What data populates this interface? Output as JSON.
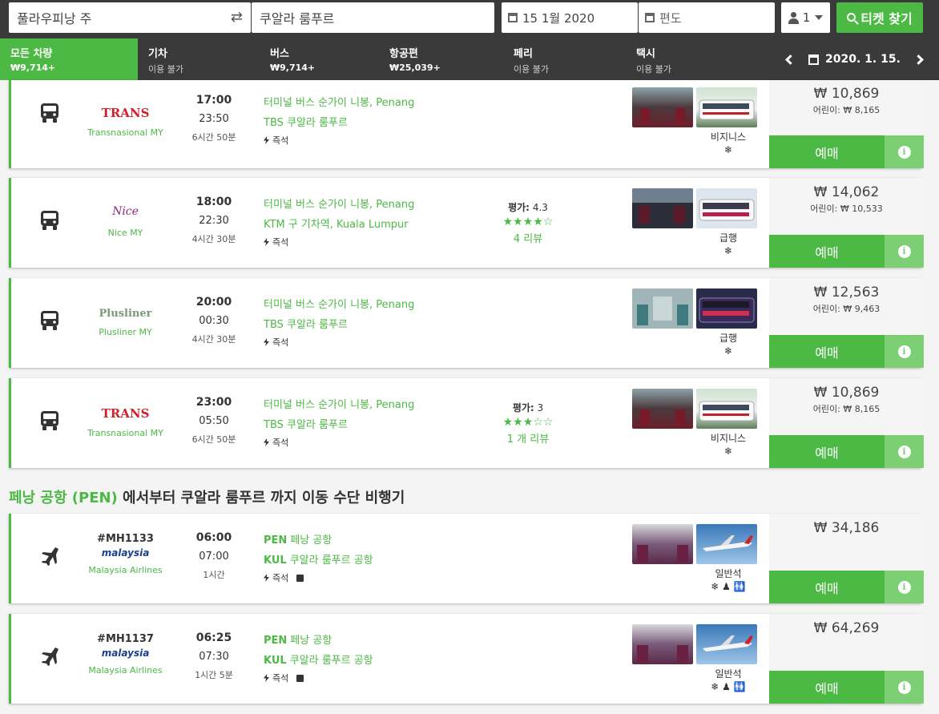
{
  "search": {
    "from": "풀라우피낭 주",
    "to": "쿠알라 룸푸르",
    "date": "15 1월 2020",
    "return_placeholder": "편도",
    "passengers": "1",
    "search_button": "티켓 찾기"
  },
  "tabs": [
    {
      "name": "모든 차량",
      "sub": "₩9,714+"
    },
    {
      "name": "기차",
      "sub": "이용 불가"
    },
    {
      "name": "버스",
      "sub": "₩9,714+"
    },
    {
      "name": "항공편",
      "sub": "₩25,039+"
    },
    {
      "name": "페리",
      "sub": "이용 불가"
    },
    {
      "name": "택시",
      "sub": "이용 불가"
    }
  ],
  "date_nav": {
    "current": "2020. 1. 15."
  },
  "results": [
    {
      "mode": "bus",
      "operator_logo": "TRANS",
      "operator": "Transnasional MY",
      "dep": "17:00",
      "arr": "23:50",
      "duration": "6시간 50분",
      "from": "터미널 버스 순가이 니봉, Penang",
      "to": "TBS 쿠알라 룸푸르",
      "feature": "즉석",
      "class": "비지니스",
      "amenity": "❄",
      "price": "₩ 10,869",
      "child": "어린이: ₩ 8,165",
      "buy": "예매"
    },
    {
      "mode": "bus",
      "operator_logo": "Nice",
      "operator": "Nice MY",
      "dep": "18:00",
      "arr": "22:30",
      "duration": "4시간 30분",
      "from": "터미널 버스 순가이 니봉, Penang",
      "to": "KTM 구 기차역, Kuala Lumpur",
      "feature": "즉석",
      "rating_label": "평가:",
      "rating_value": "4.3",
      "stars": "★★★★☆",
      "reviews": "4 리뷰",
      "class": "급행",
      "amenity": "❄",
      "price": "₩ 14,062",
      "child": "어린이: ₩ 10,533",
      "buy": "예매"
    },
    {
      "mode": "bus",
      "operator_logo": "Plusliner",
      "operator": "Plusliner MY",
      "dep": "20:00",
      "arr": "00:30",
      "duration": "4시간 30분",
      "from": "터미널 버스 순가이 니봉, Penang",
      "to": "TBS 쿠알라 룸푸르",
      "feature": "즉석",
      "class": "급행",
      "amenity": "❄",
      "price": "₩ 12,563",
      "child": "어린이: ₩ 9,463",
      "buy": "예매"
    },
    {
      "mode": "bus",
      "operator_logo": "TRANS",
      "operator": "Transnasional MY",
      "dep": "23:00",
      "arr": "05:50",
      "duration": "6시간 50분",
      "from": "터미널 버스 순가이 니봉, Penang",
      "to": "TBS 쿠알라 룸푸르",
      "feature": "즉석",
      "rating_label": "평가:",
      "rating_value": "3",
      "stars": "★★★☆☆",
      "reviews": "1 개 리뷰",
      "class": "비지니스",
      "amenity": "❄",
      "price": "₩ 10,869",
      "child": "어린이: ₩ 8,165",
      "buy": "예매"
    }
  ],
  "flights_section": {
    "highlight": "페낭 공항 (PEN)",
    "rest": " 에서부터 쿠알라 룸푸르 까지 이동 수단 비행기"
  },
  "flights": [
    {
      "mode": "plane",
      "flight_no": "#MH1133",
      "operator_logo": "malaysia",
      "operator": "Malaysia Airlines",
      "dep": "06:00",
      "arr": "07:00",
      "duration": "1시간",
      "from_code": "PEN",
      "from": "페낭 공항",
      "to_code": "KUL",
      "to": "쿠알라 룸푸르 공항",
      "feature": "즉석",
      "class": "일반석",
      "amenity": "❄ ♟ 🚻",
      "price": "₩ 34,186",
      "buy": "예매"
    },
    {
      "mode": "plane",
      "flight_no": "#MH1137",
      "operator_logo": "malaysia",
      "operator": "Malaysia Airlines",
      "dep": "06:25",
      "arr": "07:30",
      "duration": "1시간 5분",
      "from_code": "PEN",
      "from": "페낭 공항",
      "to_code": "KUL",
      "to": "쿠알라 룸푸르 공항",
      "feature": "즉석",
      "class": "일반석",
      "amenity": "❄ ♟ 🚻",
      "price": "₩ 64,269",
      "buy": "예매"
    }
  ],
  "colors": {
    "accent": "#4cb944",
    "dark": "#3a3a3a"
  }
}
